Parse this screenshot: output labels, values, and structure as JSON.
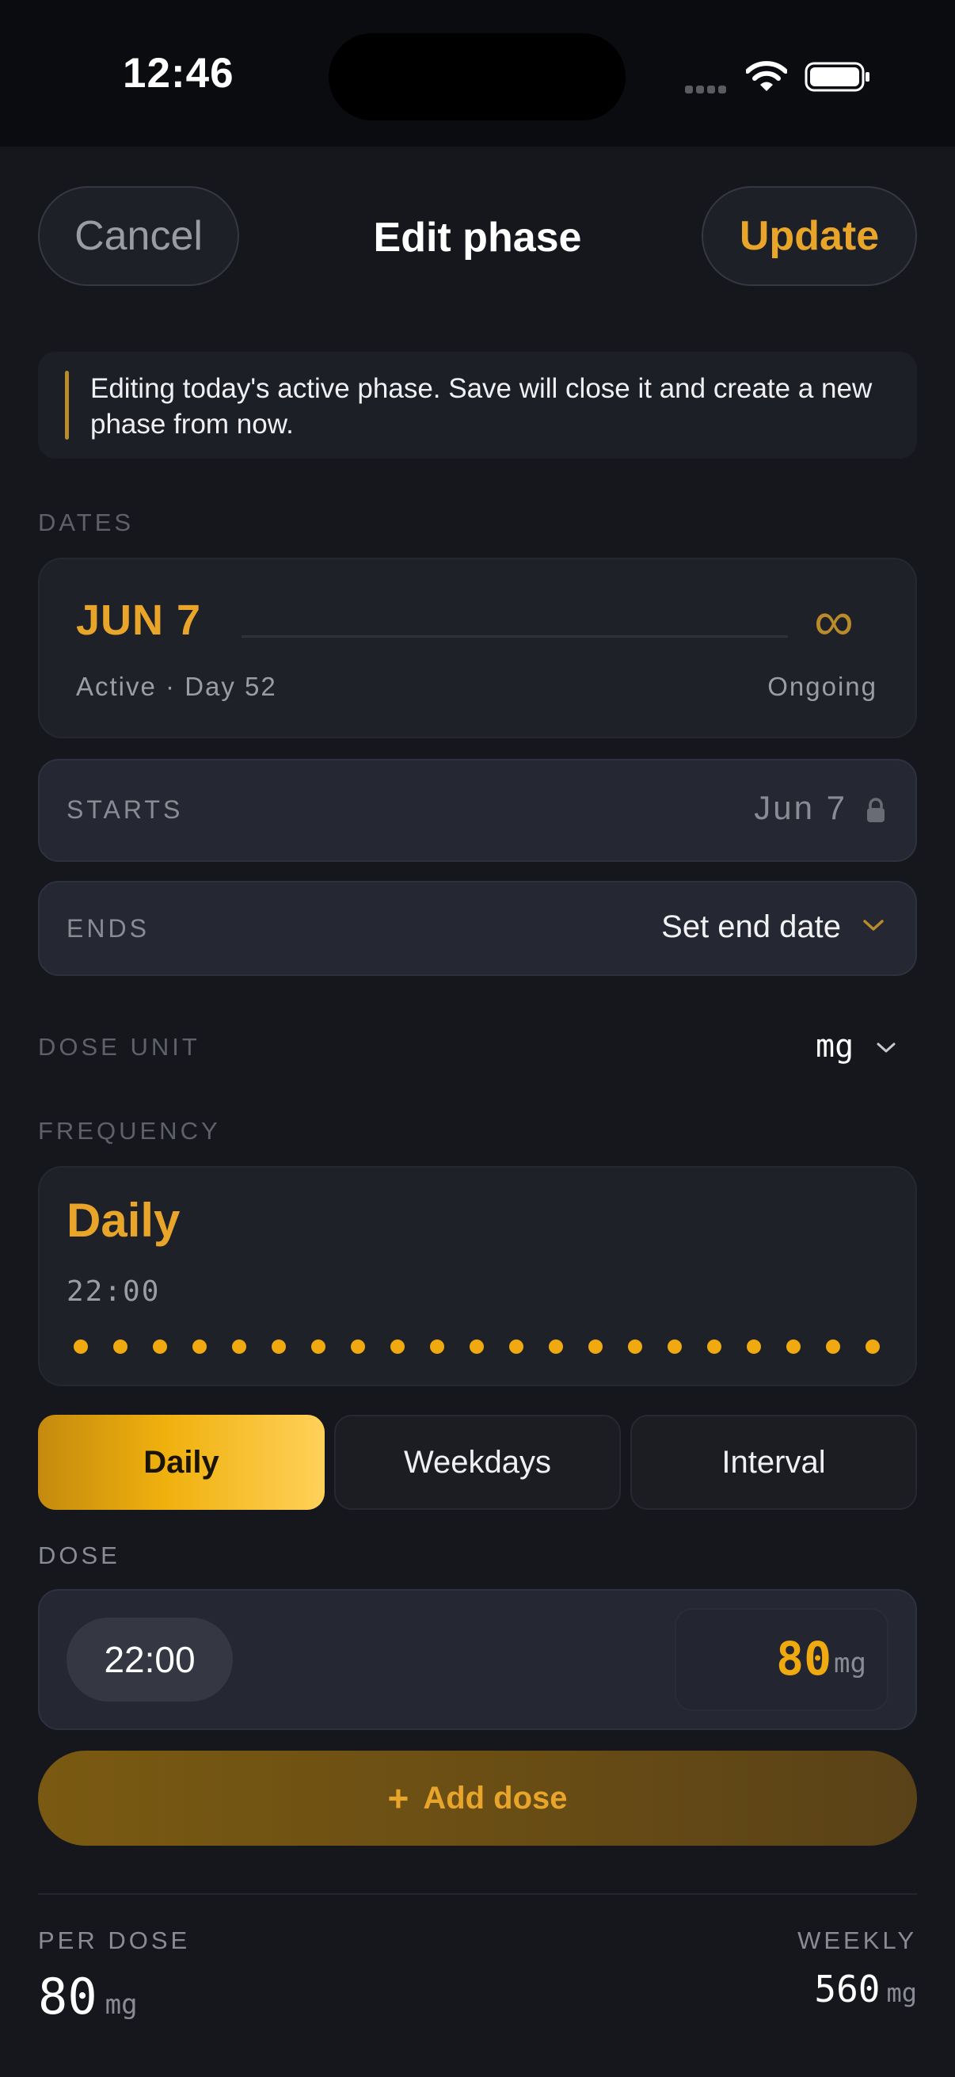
{
  "status_bar": {
    "time": "12:46"
  },
  "header": {
    "cancel_label": "Cancel",
    "title": "Edit phase",
    "update_label": "Update"
  },
  "notice": {
    "text": "Editing today's active phase. Save will close it and create a new phase from now."
  },
  "dates": {
    "section_label": "DATES",
    "start_display": "JUN 7",
    "end_symbol": "∞",
    "status_text": "Active · Day 52",
    "end_text": "Ongoing",
    "starts_label": "STARTS",
    "starts_value": "Jun 7",
    "ends_label": "ENDS",
    "ends_value": "Set end date"
  },
  "dose_unit": {
    "label": "DOSE UNIT",
    "value": "mg"
  },
  "frequency": {
    "label": "FREQUENCY",
    "title": "Daily",
    "time": "22:00",
    "dot_count": 21,
    "options": [
      "Daily",
      "Weekdays",
      "Interval"
    ],
    "selected": "Daily"
  },
  "dose": {
    "label": "DOSE",
    "time": "22:00",
    "amount": "80",
    "unit": "mg",
    "add_label": "Add dose",
    "add_symbol": "+"
  },
  "summary": {
    "per_dose_label": "PER DOSE",
    "per_dose_value": "80",
    "per_dose_unit": "mg",
    "weekly_label": "WEEKLY",
    "weekly_value": "560",
    "weekly_unit": "mg"
  },
  "colors": {
    "accent": "#e8a52a",
    "background": "#16171c",
    "card": "#1f2129"
  }
}
